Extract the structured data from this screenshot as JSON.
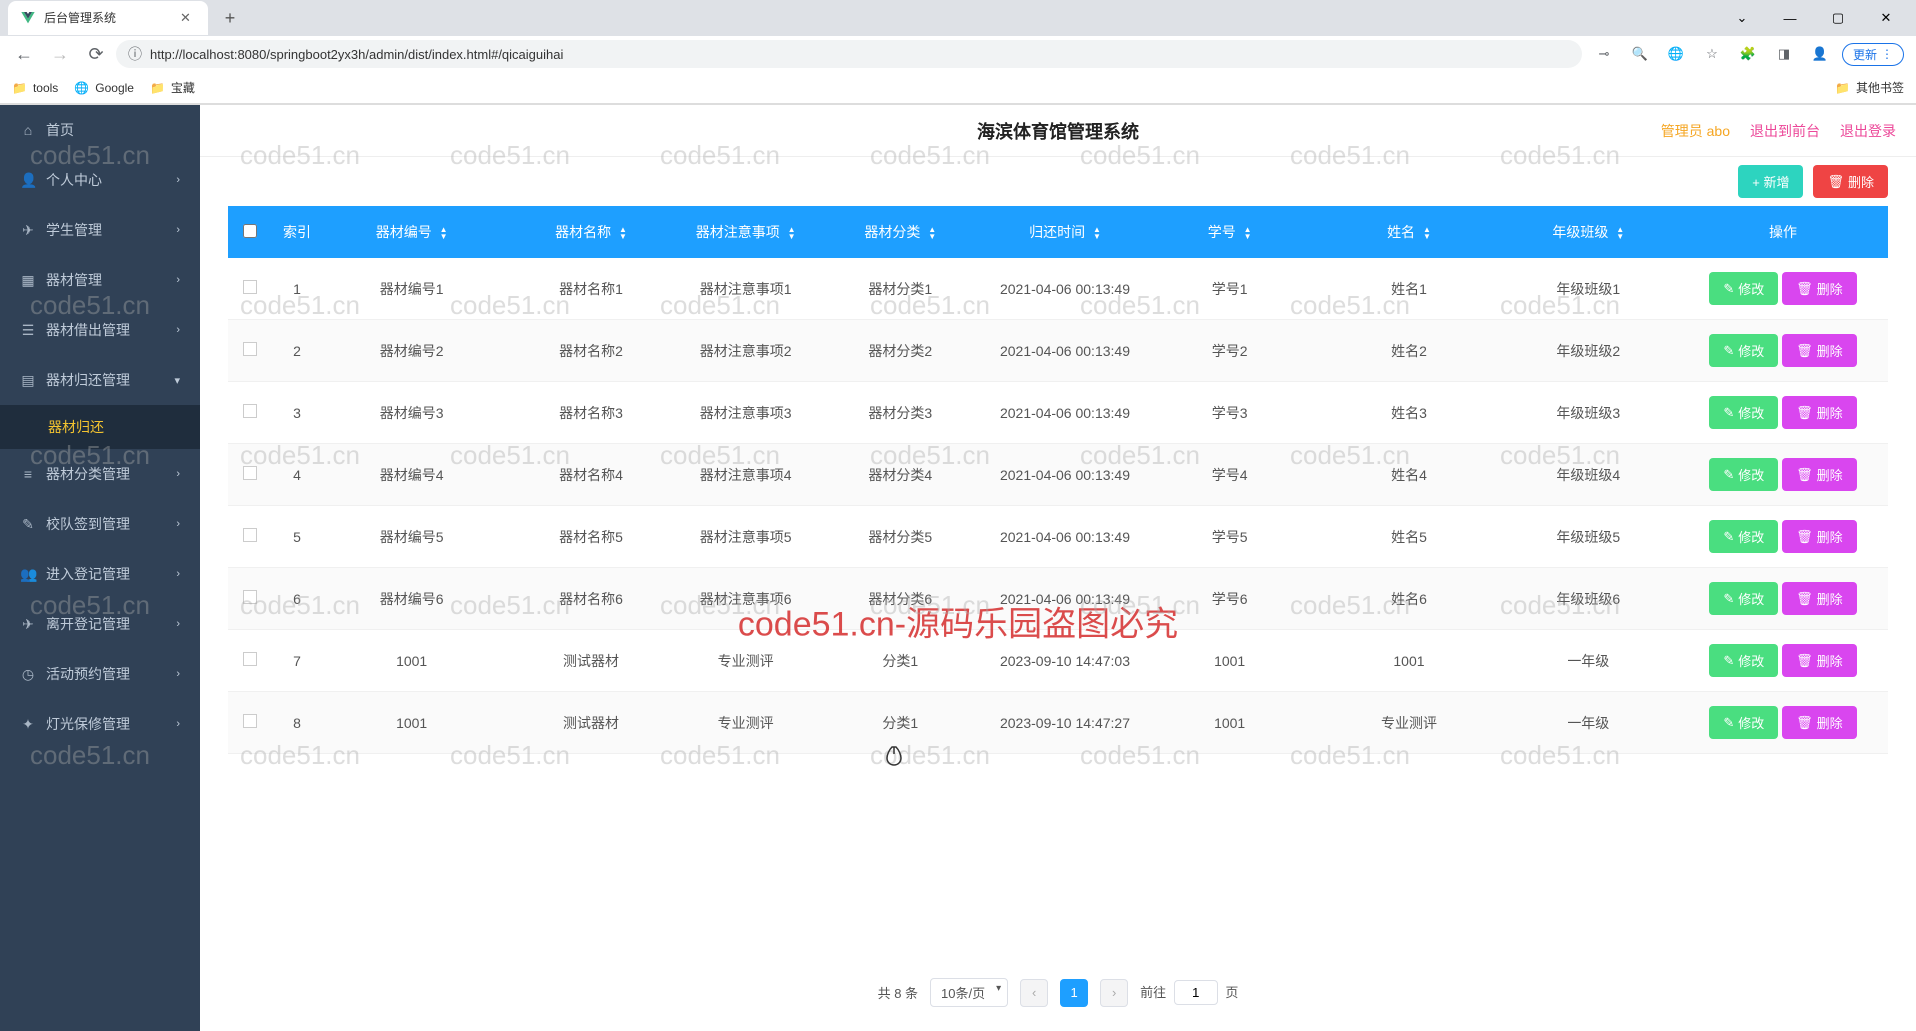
{
  "browser": {
    "tab_title": "后台管理系统",
    "url": "http://localhost:8080/springboot2yx3h/admin/dist/index.html#/qicaiguihai",
    "bookmarks": [
      "tools",
      "Google",
      "宝藏"
    ],
    "other_bookmarks": "其他书签",
    "update_btn": "更新"
  },
  "app": {
    "title": "海滨体育馆管理系统",
    "admin": "管理员 abo",
    "logout_front": "退出到前台",
    "logout": "退出登录"
  },
  "sidebar": {
    "items": [
      {
        "label": "首页",
        "icon": "⌂"
      },
      {
        "label": "个人中心",
        "icon": "👤",
        "chevron": true
      },
      {
        "label": "学生管理",
        "icon": "✈",
        "chevron": true
      },
      {
        "label": "器材管理",
        "icon": "▦",
        "chevron": true
      },
      {
        "label": "器材借出管理",
        "icon": "☰",
        "chevron": true
      },
      {
        "label": "器材归还管理",
        "icon": "▤",
        "chevron": true,
        "expanded": true,
        "sub": "器材归还"
      },
      {
        "label": "器材分类管理",
        "icon": "≡",
        "chevron": true
      },
      {
        "label": "校队签到管理",
        "icon": "✎",
        "chevron": true
      },
      {
        "label": "进入登记管理",
        "icon": "👥",
        "chevron": true
      },
      {
        "label": "离开登记管理",
        "icon": "✈",
        "chevron": true
      },
      {
        "label": "活动预约管理",
        "icon": "◷",
        "chevron": true
      },
      {
        "label": "灯光保修管理",
        "icon": "✦",
        "chevron": true
      }
    ]
  },
  "toolbar": {
    "add": "+ 新增",
    "delete": "删除"
  },
  "table": {
    "columns": [
      "索引",
      "器材编号",
      "器材名称",
      "器材注意事项",
      "器材分类",
      "归还时间",
      "学号",
      "姓名",
      "年级班级",
      "操作"
    ],
    "edit_label": "修改",
    "delete_label": "删除",
    "rows": [
      {
        "idx": "1",
        "code": "器材编号1",
        "name": "器材名称1",
        "note": "器材注意事项1",
        "cat": "器材分类1",
        "time": "2021-04-06 00:13:49",
        "sno": "学号1",
        "sname": "姓名1",
        "grade": "年级班级1"
      },
      {
        "idx": "2",
        "code": "器材编号2",
        "name": "器材名称2",
        "note": "器材注意事项2",
        "cat": "器材分类2",
        "time": "2021-04-06 00:13:49",
        "sno": "学号2",
        "sname": "姓名2",
        "grade": "年级班级2"
      },
      {
        "idx": "3",
        "code": "器材编号3",
        "name": "器材名称3",
        "note": "器材注意事项3",
        "cat": "器材分类3",
        "time": "2021-04-06 00:13:49",
        "sno": "学号3",
        "sname": "姓名3",
        "grade": "年级班级3"
      },
      {
        "idx": "4",
        "code": "器材编号4",
        "name": "器材名称4",
        "note": "器材注意事项4",
        "cat": "器材分类4",
        "time": "2021-04-06 00:13:49",
        "sno": "学号4",
        "sname": "姓名4",
        "grade": "年级班级4"
      },
      {
        "idx": "5",
        "code": "器材编号5",
        "name": "器材名称5",
        "note": "器材注意事项5",
        "cat": "器材分类5",
        "time": "2021-04-06 00:13:49",
        "sno": "学号5",
        "sname": "姓名5",
        "grade": "年级班级5"
      },
      {
        "idx": "6",
        "code": "器材编号6",
        "name": "器材名称6",
        "note": "器材注意事项6",
        "cat": "器材分类6",
        "time": "2021-04-06 00:13:49",
        "sno": "学号6",
        "sname": "姓名6",
        "grade": "年级班级6"
      },
      {
        "idx": "7",
        "code": "1001",
        "name": "测试器材",
        "note": "专业测评",
        "cat": "分类1",
        "time": "2023-09-10 14:47:03",
        "sno": "1001",
        "sname": "1001",
        "grade": "一年级"
      },
      {
        "idx": "8",
        "code": "1001",
        "name": "测试器材",
        "note": "专业测评",
        "cat": "分类1",
        "time": "2023-09-10 14:47:27",
        "sno": "1001",
        "sname": "专业测评",
        "grade": "一年级"
      }
    ]
  },
  "pagination": {
    "total": "共 8 条",
    "page_size": "10条/页",
    "current": "1",
    "jump_prefix": "前往",
    "jump_suffix": "页",
    "jump_value": "1"
  },
  "watermark": {
    "grey": "code51.cn",
    "red": "code51.cn-源码乐园盗图必究"
  }
}
